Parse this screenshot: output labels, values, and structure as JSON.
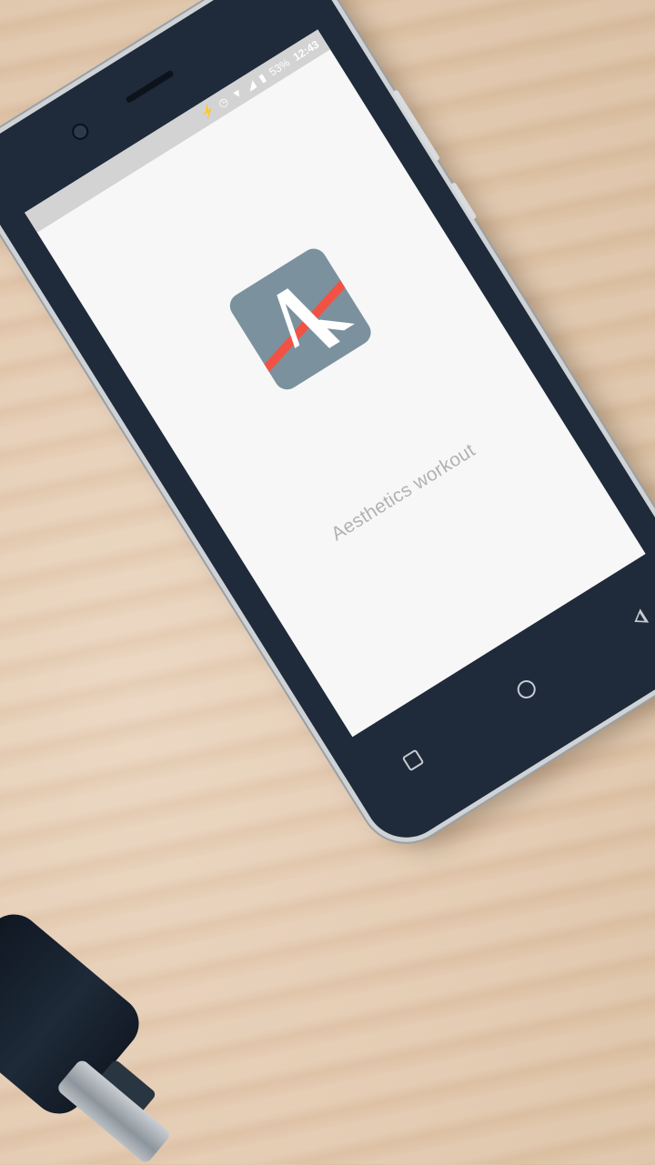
{
  "statusbar": {
    "battery_percent": "53%",
    "time": "12:43",
    "icons": [
      "usb-icon",
      "alarm-icon",
      "wifi-icon",
      "signal-icon",
      "battery-icon"
    ]
  },
  "splash": {
    "app_name": "Aesthetics workout",
    "logo_colors": {
      "background": "#7b919e",
      "stripe": "#f25244",
      "mark": "#ffffff"
    }
  },
  "navbar": {
    "buttons": [
      "recent-apps",
      "home",
      "back"
    ]
  }
}
